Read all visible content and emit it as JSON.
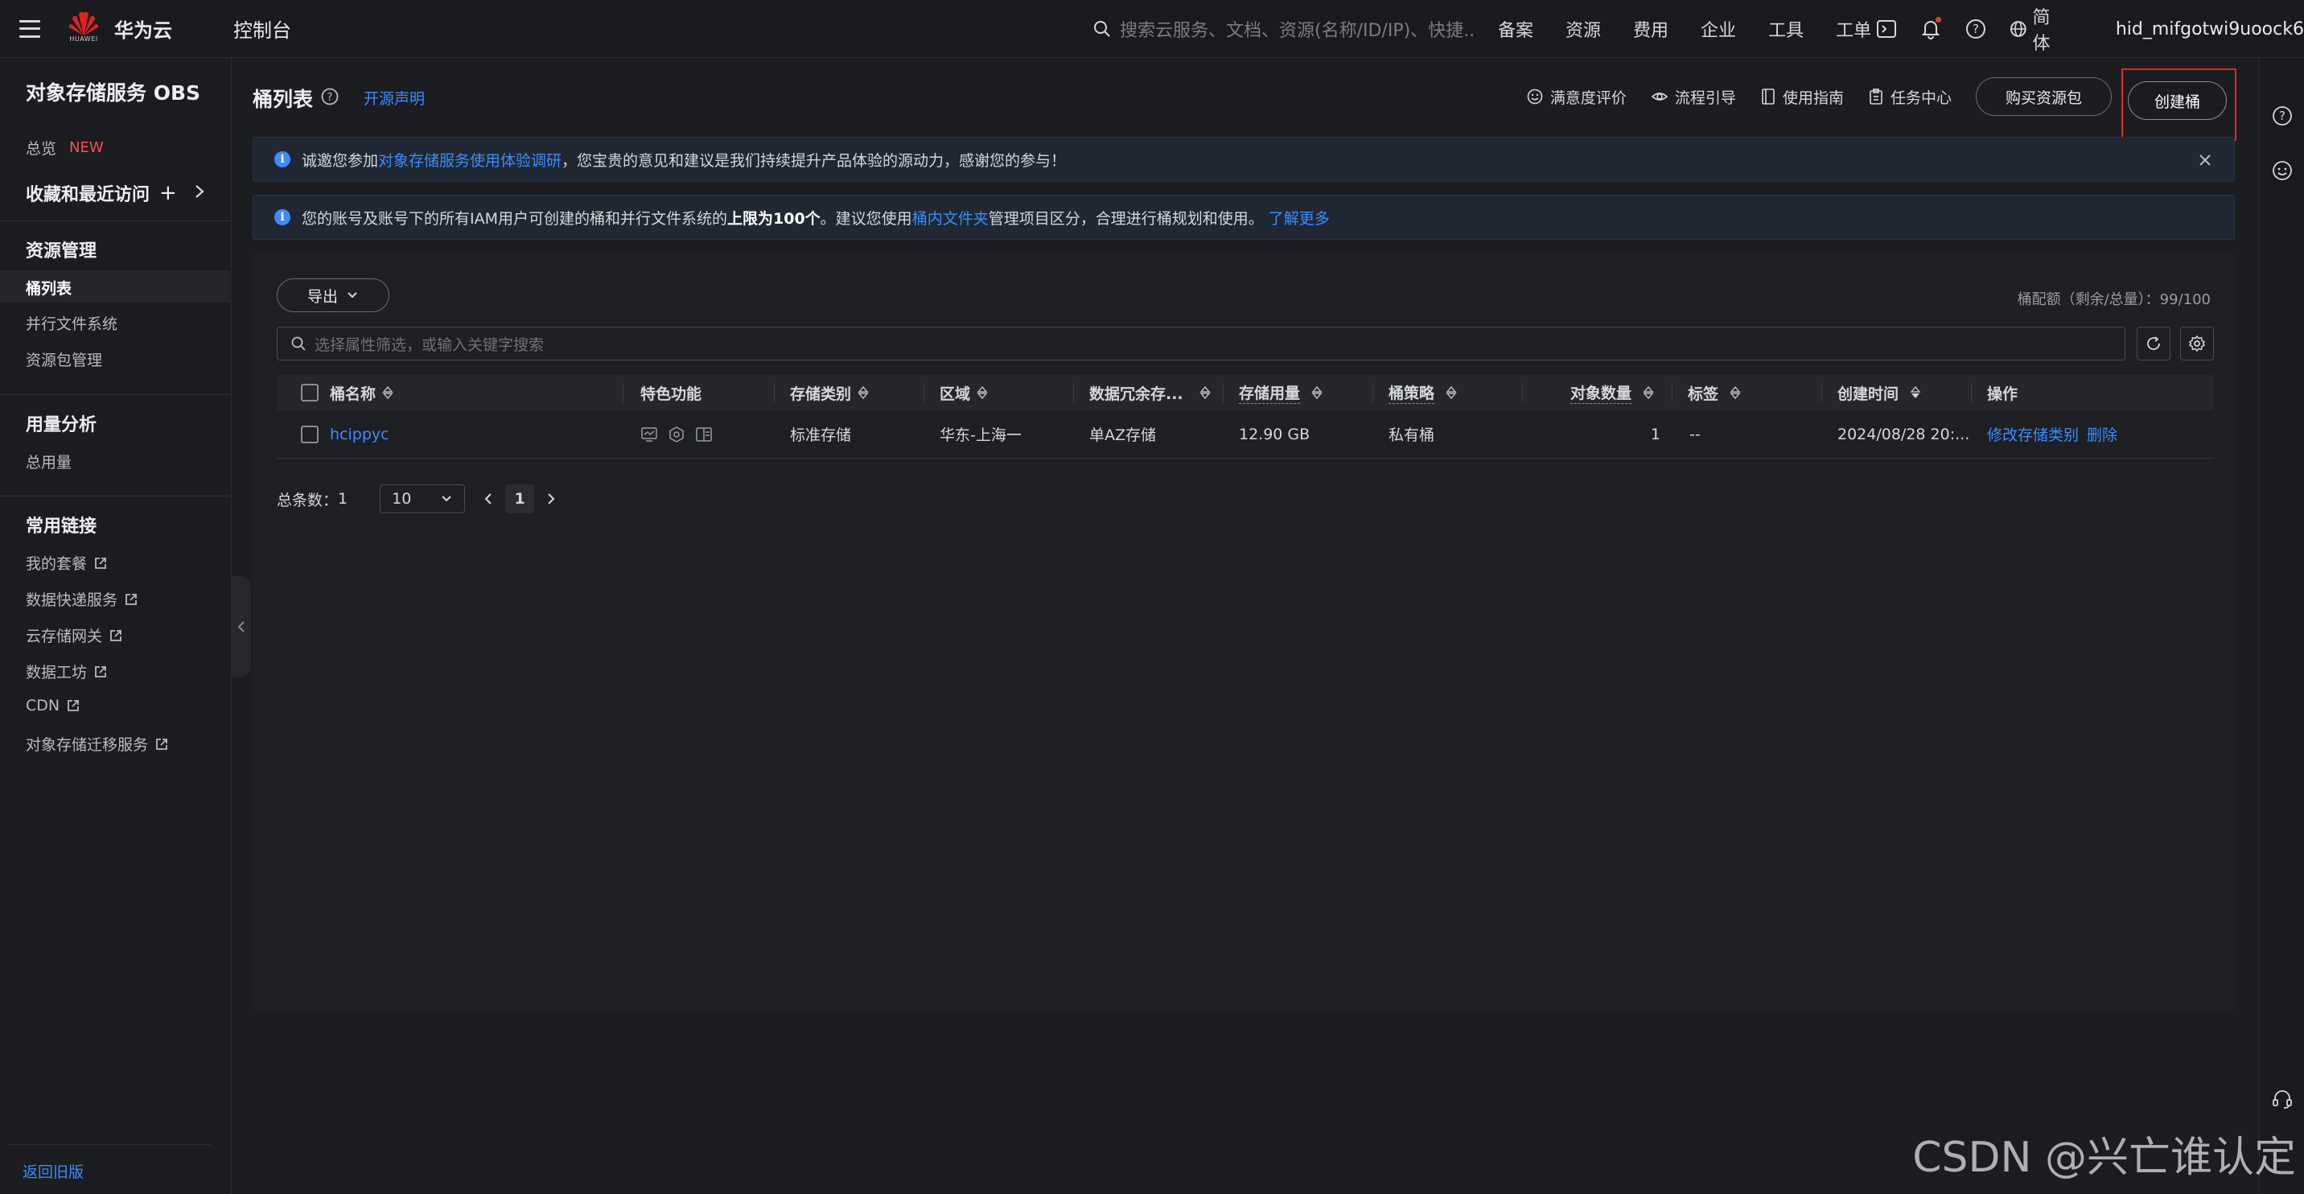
{
  "topbar": {
    "brand": "华为云",
    "logo_text": "HUAWEI",
    "console": "控制台",
    "search_placeholder": "搜索云服务、文档、资源(名称/ID/IP)、快捷...",
    "nav": [
      "备案",
      "资源",
      "费用",
      "企业",
      "工具",
      "工单"
    ],
    "lang": "简体",
    "username": "hid_mifgotwi9uoock6"
  },
  "sidebar": {
    "title": "对象存储服务 OBS",
    "overview": "总览",
    "new_badge": "NEW",
    "favorites": "收藏和最近访问",
    "section_resource": "资源管理",
    "bucket_list": "桶列表",
    "parallel_fs": "并行文件系统",
    "package_mgmt": "资源包管理",
    "section_usage": "用量分析",
    "total_usage": "总用量",
    "section_links": "常用链接",
    "links": [
      "我的套餐",
      "数据快递服务",
      "云存储网关",
      "数据工坊",
      "CDN",
      "对象存储迁移服务"
    ],
    "old_version": "返回旧版"
  },
  "header": {
    "title": "桶列表",
    "oss_link": "开源声明",
    "satisfaction": "满意度评价",
    "flow_guide": "流程引导",
    "user_guide": "使用指南",
    "task_center": "任务中心",
    "buy_package": "购买资源包",
    "create_bucket": "创建桶"
  },
  "notice1": {
    "pre": "诚邀您参加",
    "link": "对象存储服务使用体验调研",
    "post": "，您宝贵的意见和建议是我们持续提升产品体验的源动力，感谢您的参与！"
  },
  "notice2": {
    "pre": "您的账号及账号下的所有IAM用户可创建的桶和并行文件系统的",
    "bold": "上限为100个",
    "mid": "。建议您使用",
    "link1": "桶内文件夹",
    "post": "管理项目区分，合理进行桶规划和使用。",
    "link2": "了解更多"
  },
  "panel": {
    "export": "导出",
    "quota": "桶配额（剩余/总量）：99/100",
    "filter_placeholder": "选择属性筛选，或输入关键字搜索"
  },
  "table": {
    "headers": {
      "name": "桶名称",
      "features": "特色功能",
      "storage_class": "存储类别",
      "region": "区域",
      "redundancy": "数据冗余存...",
      "usage": "存储用量",
      "policy": "桶策略",
      "objects": "对象数量",
      "tags": "标签",
      "created": "创建时间",
      "actions": "操作"
    },
    "rows": [
      {
        "name": "hcippyc",
        "storage_class": "标准存储",
        "region": "华东-上海一",
        "redundancy": "单AZ存储",
        "usage": "12.90 GB",
        "policy": "私有桶",
        "objects": "1",
        "tags": "--",
        "created": "2024/08/28 20:...",
        "action_modify": "修改存储类别",
        "action_delete": "删除"
      }
    ]
  },
  "pager": {
    "total_label": "总条数：",
    "total": "1",
    "page_size": "10",
    "current_page": "1"
  },
  "watermark": "CSDN @兴亡谁认定",
  "colors": {
    "accent": "#3c8cff",
    "highlight_box": "#e0272a",
    "badge_new": "#f5534f",
    "background": "#1c1d21"
  }
}
